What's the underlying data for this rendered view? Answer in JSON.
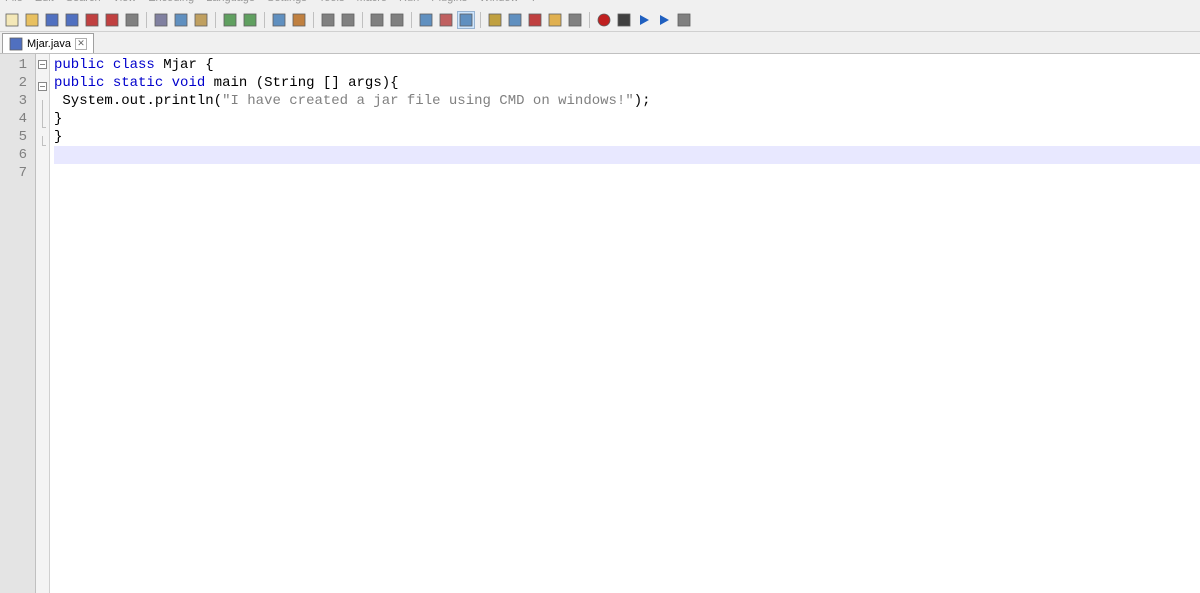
{
  "menu": {
    "items": [
      "File",
      "Edit",
      "Search",
      "View",
      "Encoding",
      "Language",
      "Settings",
      "Tools",
      "Macro",
      "Run",
      "Plugins",
      "Window",
      "?"
    ]
  },
  "toolbar": {
    "groups": [
      [
        "new-file-icon",
        "open-file-icon",
        "save-icon",
        "save-all-icon",
        "close-icon",
        "close-all-icon",
        "print-icon"
      ],
      [
        "cut-icon",
        "copy-icon",
        "paste-icon"
      ],
      [
        "undo-icon",
        "redo-icon"
      ],
      [
        "find-icon",
        "replace-icon"
      ],
      [
        "zoom-in-icon",
        "zoom-out-icon"
      ],
      [
        "sync-v-icon",
        "sync-h-icon"
      ],
      [
        "wordwrap-icon",
        "all-chars-icon",
        "indent-guide-icon"
      ],
      [
        "lang-icon",
        "doc-map-icon",
        "func-list-icon",
        "folder-icon",
        "monitor-icon"
      ],
      [
        "record-icon",
        "stop-icon",
        "play-icon",
        "play-multi-icon",
        "save-macro-icon"
      ]
    ],
    "active": "indent-guide-icon"
  },
  "tabs": [
    {
      "icon": "java-file-icon",
      "label": "Mjar.java",
      "close": "✕"
    }
  ],
  "editor": {
    "lines": [
      {
        "n": 1,
        "fold": "box",
        "tokens": [
          {
            "t": "public",
            "c": "kw"
          },
          {
            "t": " ",
            "c": ""
          },
          {
            "t": "class",
            "c": "kw"
          },
          {
            "t": " ",
            "c": ""
          },
          {
            "t": "Mjar",
            "c": "id"
          },
          {
            "t": " {",
            "c": "id"
          }
        ]
      },
      {
        "n": 2,
        "fold": "box",
        "tokens": [
          {
            "t": "public",
            "c": "kw"
          },
          {
            "t": " ",
            "c": ""
          },
          {
            "t": "static",
            "c": "kw"
          },
          {
            "t": " ",
            "c": ""
          },
          {
            "t": "void",
            "c": "kw"
          },
          {
            "t": " ",
            "c": ""
          },
          {
            "t": "main",
            "c": "id"
          },
          {
            "t": " ",
            "c": ""
          },
          {
            "t": "(",
            "c": "id"
          },
          {
            "t": "String",
            "c": "id"
          },
          {
            "t": " [] ",
            "c": "id"
          },
          {
            "t": "args",
            "c": "id"
          },
          {
            "t": ")",
            "c": "id"
          },
          {
            "t": "{",
            "c": "id"
          }
        ]
      },
      {
        "n": 3,
        "fold": "line",
        "tokens": [
          {
            "t": " System",
            "c": "id"
          },
          {
            "t": ".",
            "c": "id"
          },
          {
            "t": "out",
            "c": "id"
          },
          {
            "t": ".",
            "c": "id"
          },
          {
            "t": "println",
            "c": "id"
          },
          {
            "t": "(",
            "c": "id"
          },
          {
            "t": "\"I have created a jar file using CMD on windows!\"",
            "c": "str"
          },
          {
            "t": ")",
            "c": "id"
          },
          {
            "t": ";",
            "c": "id"
          }
        ]
      },
      {
        "n": 4,
        "fold": "corner",
        "tokens": [
          {
            "t": "}",
            "c": "id"
          }
        ]
      },
      {
        "n": 5,
        "fold": "corner",
        "tokens": [
          {
            "t": "}",
            "c": "id"
          }
        ]
      },
      {
        "n": 6,
        "fold": "",
        "current": true,
        "tokens": []
      },
      {
        "n": 7,
        "fold": "",
        "tokens": []
      }
    ]
  },
  "icons": {
    "new-file-icon": "#f4e8b8",
    "open-file-icon": "#e8c060",
    "save-icon": "#5070c0",
    "save-all-icon": "#5070c0",
    "close-icon": "#c04040",
    "close-all-icon": "#c04040",
    "print-icon": "#808080",
    "cut-icon": "#8080a0",
    "copy-icon": "#6090c0",
    "paste-icon": "#c0a060",
    "undo-icon": "#60a060",
    "redo-icon": "#60a060",
    "find-icon": "#6090c0",
    "replace-icon": "#c08040",
    "zoom-in-icon": "#808080",
    "zoom-out-icon": "#808080",
    "sync-v-icon": "#808080",
    "sync-h-icon": "#808080",
    "wordwrap-icon": "#6090c0",
    "all-chars-icon": "#c06060",
    "indent-guide-icon": "#6090c0",
    "lang-icon": "#c0a040",
    "doc-map-icon": "#6090c0",
    "func-list-icon": "#c04040",
    "folder-icon": "#e0b050",
    "monitor-icon": "#808080",
    "record-icon": "#c02020",
    "stop-icon": "#404040",
    "play-icon": "#2060c0",
    "play-multi-icon": "#2060c0",
    "save-macro-icon": "#808080",
    "java-file-icon": "#5070c0"
  }
}
